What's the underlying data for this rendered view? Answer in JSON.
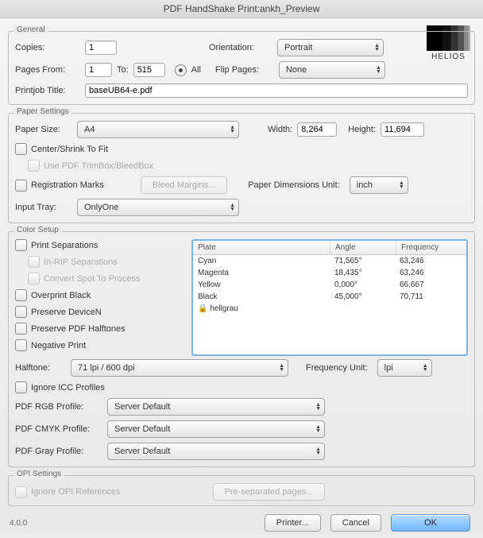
{
  "title": "PDF HandShake Print:ankh_Preview",
  "brand": "HELIOS",
  "version": "4.0.0",
  "general": {
    "legend": "General",
    "copies_label": "Copies:",
    "copies_value": "1",
    "orientation_label": "Orientation:",
    "orientation_value": "Portrait",
    "pages_from_label": "Pages From:",
    "pages_from_value": "1",
    "to_label": "To:",
    "to_value": "515",
    "all_label": "All",
    "flip_label": "Flip Pages:",
    "flip_value": "None",
    "printjob_label": "Printjob Title:",
    "printjob_value": "baseUB64-e.pdf"
  },
  "paper": {
    "legend": "Paper Settings",
    "size_label": "Paper Size:",
    "size_value": "A4",
    "width_label": "Width:",
    "width_value": "8,264",
    "height_label": "Height:",
    "height_value": "11,694",
    "center_label": "Center/Shrink To Fit",
    "trimbox_label": "Use PDF TrimBox/BleedBox",
    "regmarks_label": "Registration Marks",
    "bleed_btn": "Bleed Margins...",
    "unit_label": "Paper Dimensions Unit:",
    "unit_value": "inch",
    "tray_label": "Input Tray:",
    "tray_value": "OnlyOne"
  },
  "color": {
    "legend": "Color Setup",
    "print_sep": "Print Separations",
    "inrip": "In-RIP Separations",
    "spot": "Convert Spot To Process",
    "overprint": "Overprint Black",
    "devicen": "Preserve DeviceN",
    "pdfhalftone": "Preserve PDF Halftones",
    "negative": "Negative Print",
    "halftone_label": "Halftone:",
    "halftone_value": "71 lpi / 600 dpi",
    "frequnit_label": "Frequency Unit:",
    "frequnit_value": "lpi",
    "ignoreicc": "Ignore ICC Profiles",
    "rgb_label": "PDF RGB Profile:",
    "rgb_value": "Server Default",
    "cmyk_label": "PDF CMYK Profile:",
    "cmyk_value": "Server Default",
    "gray_label": "PDF Gray Profile:",
    "gray_value": "Server Default",
    "table": {
      "h_plate": "Plate",
      "h_angle": "Angle",
      "h_freq": "Frequency",
      "rows": [
        {
          "plate": "Cyan",
          "angle": "71,565°",
          "freq": "63,246"
        },
        {
          "plate": "Magenta",
          "angle": "18,435°",
          "freq": "63,246"
        },
        {
          "plate": "Yellow",
          "angle": "0,000°",
          "freq": "66,667"
        },
        {
          "plate": "Black",
          "angle": "45,000°",
          "freq": "70,711"
        },
        {
          "plate": "hellgrau",
          "angle": "",
          "freq": "",
          "locked": true
        }
      ]
    }
  },
  "opi": {
    "legend": "OPI Settings",
    "ignore_label": "Ignore OPI References",
    "presep_btn": "Pre-separated pages..."
  },
  "footer": {
    "printer": "Printer...",
    "cancel": "Cancel",
    "ok": "OK"
  }
}
